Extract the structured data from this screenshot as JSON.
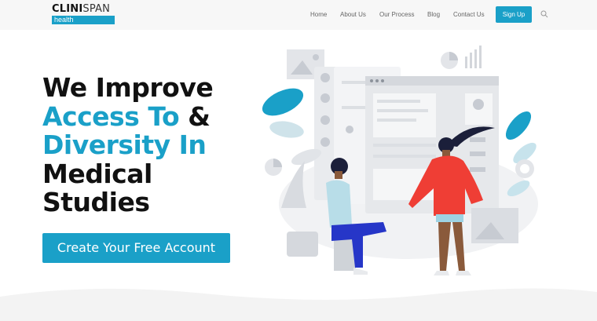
{
  "brand": {
    "name_bold": "CLINI",
    "name_thin": "SPAN",
    "sub": "health"
  },
  "nav": {
    "items": [
      "Home",
      "About Us",
      "Our Process",
      "Blog",
      "Contact Us"
    ],
    "signup_label": "Sign Up",
    "search_icon": "search-icon"
  },
  "hero": {
    "line1": "We Improve",
    "line2_accent": "Access To",
    "line2_rest": " &",
    "line3_accent": "Diversity In",
    "line4": "Medical",
    "line5": "Studies",
    "cta_label": "Create Your Free Account"
  },
  "colors": {
    "accent": "#1aa0c8",
    "header_bg": "#f7f7f7",
    "jacket": "#ef3e35",
    "pants": "#2636c8"
  }
}
